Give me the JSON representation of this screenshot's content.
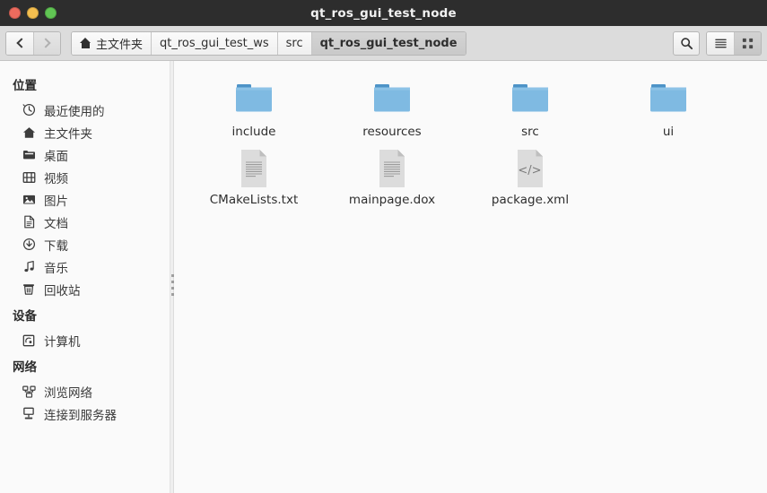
{
  "window": {
    "title": "qt_ros_gui_test_node",
    "controls": {
      "close_label": "close",
      "minimize_label": "minimize",
      "maximize_label": "maximize"
    },
    "colors": {
      "titlebar_bg": "#2d2d2d",
      "toolbar_bg": "#dcdcdc",
      "content_bg": "#fafafa",
      "folder_blue": "#7eb8e0",
      "folder_blue_dark": "#5a9fd0",
      "traffic_red": "#ed6b5e",
      "traffic_yellow": "#f5bf4f",
      "traffic_green": "#61c554"
    }
  },
  "toolbar": {
    "back_label": "后退",
    "forward_label": "前进",
    "back_enabled": true,
    "forward_enabled": false,
    "breadcrumbs": [
      {
        "label": "主文件夹",
        "icon": "home-icon",
        "active": false
      },
      {
        "label": "qt_ros_gui_test_ws",
        "icon": "",
        "active": false
      },
      {
        "label": "src",
        "icon": "",
        "active": false
      },
      {
        "label": "qt_ros_gui_test_node",
        "icon": "",
        "active": true
      }
    ],
    "search_label": "搜索",
    "list_view_label": "列表视图",
    "grid_view_label": "图标视图",
    "active_view": "grid"
  },
  "sidebar": {
    "sections": [
      {
        "title": "位置",
        "items": [
          {
            "label": "最近使用的",
            "icon": "clock-icon"
          },
          {
            "label": "主文件夹",
            "icon": "home-icon"
          },
          {
            "label": "桌面",
            "icon": "desktop-folder-icon"
          },
          {
            "label": "视频",
            "icon": "film-icon"
          },
          {
            "label": "图片",
            "icon": "image-icon"
          },
          {
            "label": "文档",
            "icon": "document-icon"
          },
          {
            "label": "下载",
            "icon": "download-icon"
          },
          {
            "label": "音乐",
            "icon": "music-note-icon"
          },
          {
            "label": "回收站",
            "icon": "trash-icon"
          }
        ]
      },
      {
        "title": "设备",
        "items": [
          {
            "label": "计算机",
            "icon": "computer-icon"
          }
        ]
      },
      {
        "title": "网络",
        "items": [
          {
            "label": "浏览网络",
            "icon": "network-browse-icon"
          },
          {
            "label": "连接到服务器",
            "icon": "server-connect-icon"
          }
        ]
      }
    ]
  },
  "files": {
    "items": [
      {
        "name": "include",
        "type": "folder"
      },
      {
        "name": "resources",
        "type": "folder"
      },
      {
        "name": "src",
        "type": "folder"
      },
      {
        "name": "ui",
        "type": "folder"
      },
      {
        "name": "CMakeLists.txt",
        "type": "text"
      },
      {
        "name": "mainpage.dox",
        "type": "text"
      },
      {
        "name": "package.xml",
        "type": "xml"
      }
    ]
  }
}
